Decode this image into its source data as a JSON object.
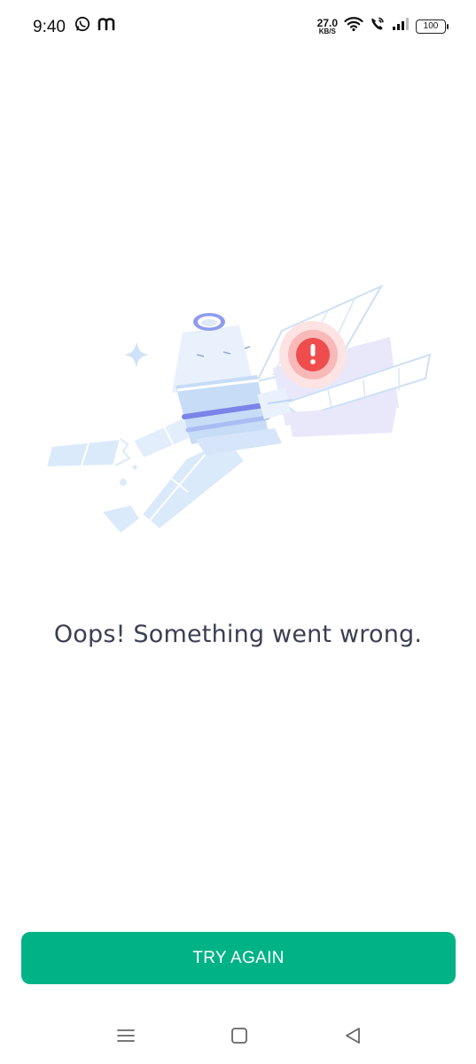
{
  "status_bar": {
    "time": "9:40",
    "left_icons": [
      "whatsapp-icon",
      "m-app-icon"
    ],
    "network_speed": "27.0",
    "network_speed_unit": "KB/S",
    "battery": "100",
    "right_icons": [
      "wifi-icon",
      "volte-call-icon",
      "signal-icon",
      "battery-icon"
    ]
  },
  "content": {
    "illustration": "broken-satellite-illustration",
    "error_message": "Oops! Something went wrong."
  },
  "actions": {
    "try_again_label": "TRY AGAIN"
  },
  "navigation": {
    "icons": [
      "menu-icon",
      "home-icon",
      "back-icon"
    ]
  },
  "colors": {
    "accent": "#00b386",
    "error_text": "#3c3f52",
    "alert_red": "#ef4d4d"
  }
}
